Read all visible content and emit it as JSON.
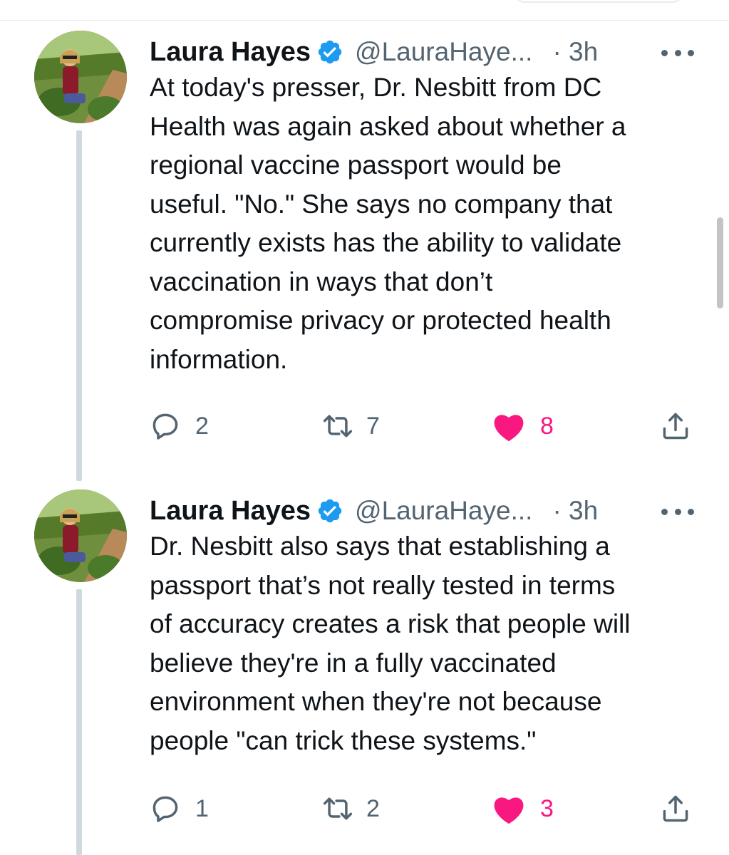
{
  "tweets": [
    {
      "author_name": "Laura Hayes",
      "handle": "@LauraHaye...",
      "time": "· 3h",
      "text": "At today's presser, Dr. Nesbitt from DC\nHealth was again asked about whether a\nregional vaccine passport would be\nuseful. \"No.\" She says no company that\ncurrently exists has the ability to validate\nvaccination in ways that don’t\ncompromise privacy or protected health\ninformation.",
      "replies": "2",
      "retweets": "7",
      "likes": "8"
    },
    {
      "author_name": "Laura Hayes",
      "handle": "@LauraHaye...",
      "time": "· 3h",
      "text": "Dr. Nesbitt also says that establishing a\npassport that’s not really tested in terms\nof accuracy creates a risk that people will\nbelieve they're in a fully vaccinated\nenvironment when they're not because\npeople \"can trick these systems.\"",
      "replies": "1",
      "retweets": "2",
      "likes": "3"
    }
  ],
  "colors": {
    "verified": "#1d9bf0",
    "liked": "#f91880",
    "secondary_text": "#536471",
    "thread_line": "#cfd9de"
  },
  "icons": [
    "verified-badge-icon",
    "more-icon",
    "reply-icon",
    "retweet-icon",
    "like-icon",
    "share-icon"
  ]
}
